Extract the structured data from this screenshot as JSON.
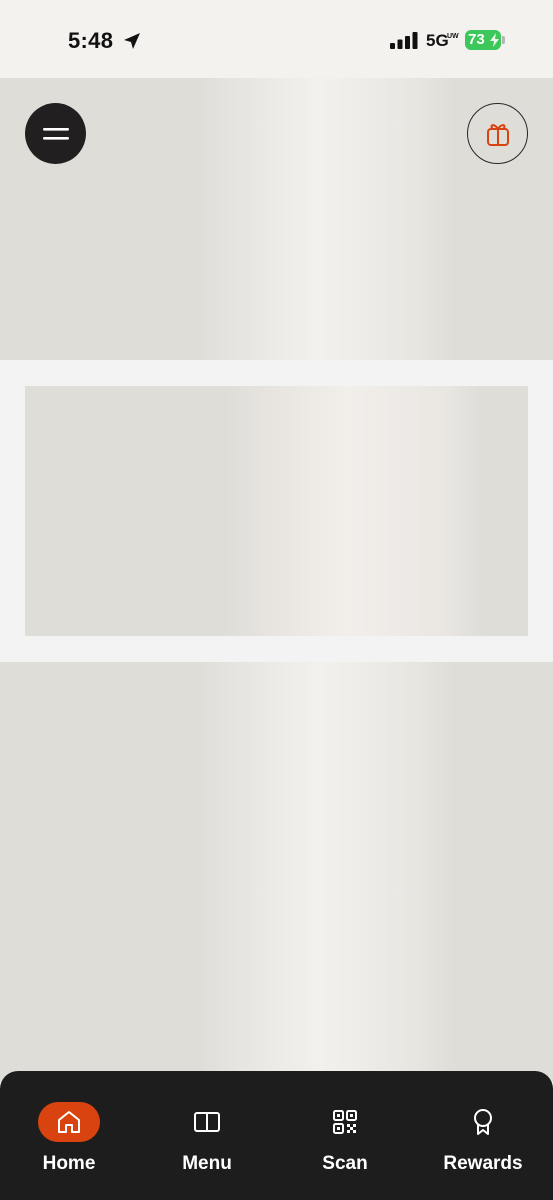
{
  "status_bar": {
    "time": "5:48",
    "network": "5G",
    "network_badge": "UW",
    "battery": "73"
  },
  "header": {
    "menu_icon": "hamburger-icon",
    "gift_icon": "gift-icon"
  },
  "tabs": [
    {
      "label": "Home",
      "icon": "home-icon",
      "active": true
    },
    {
      "label": "Menu",
      "icon": "book-icon",
      "active": false
    },
    {
      "label": "Scan",
      "icon": "qr-code-icon",
      "active": false
    },
    {
      "label": "Rewards",
      "icon": "award-icon",
      "active": false
    }
  ],
  "colors": {
    "accent": "#d9430f",
    "tab_bar": "#1d1d1d",
    "menu_button": "#221f20",
    "battery": "#3cc75a"
  }
}
